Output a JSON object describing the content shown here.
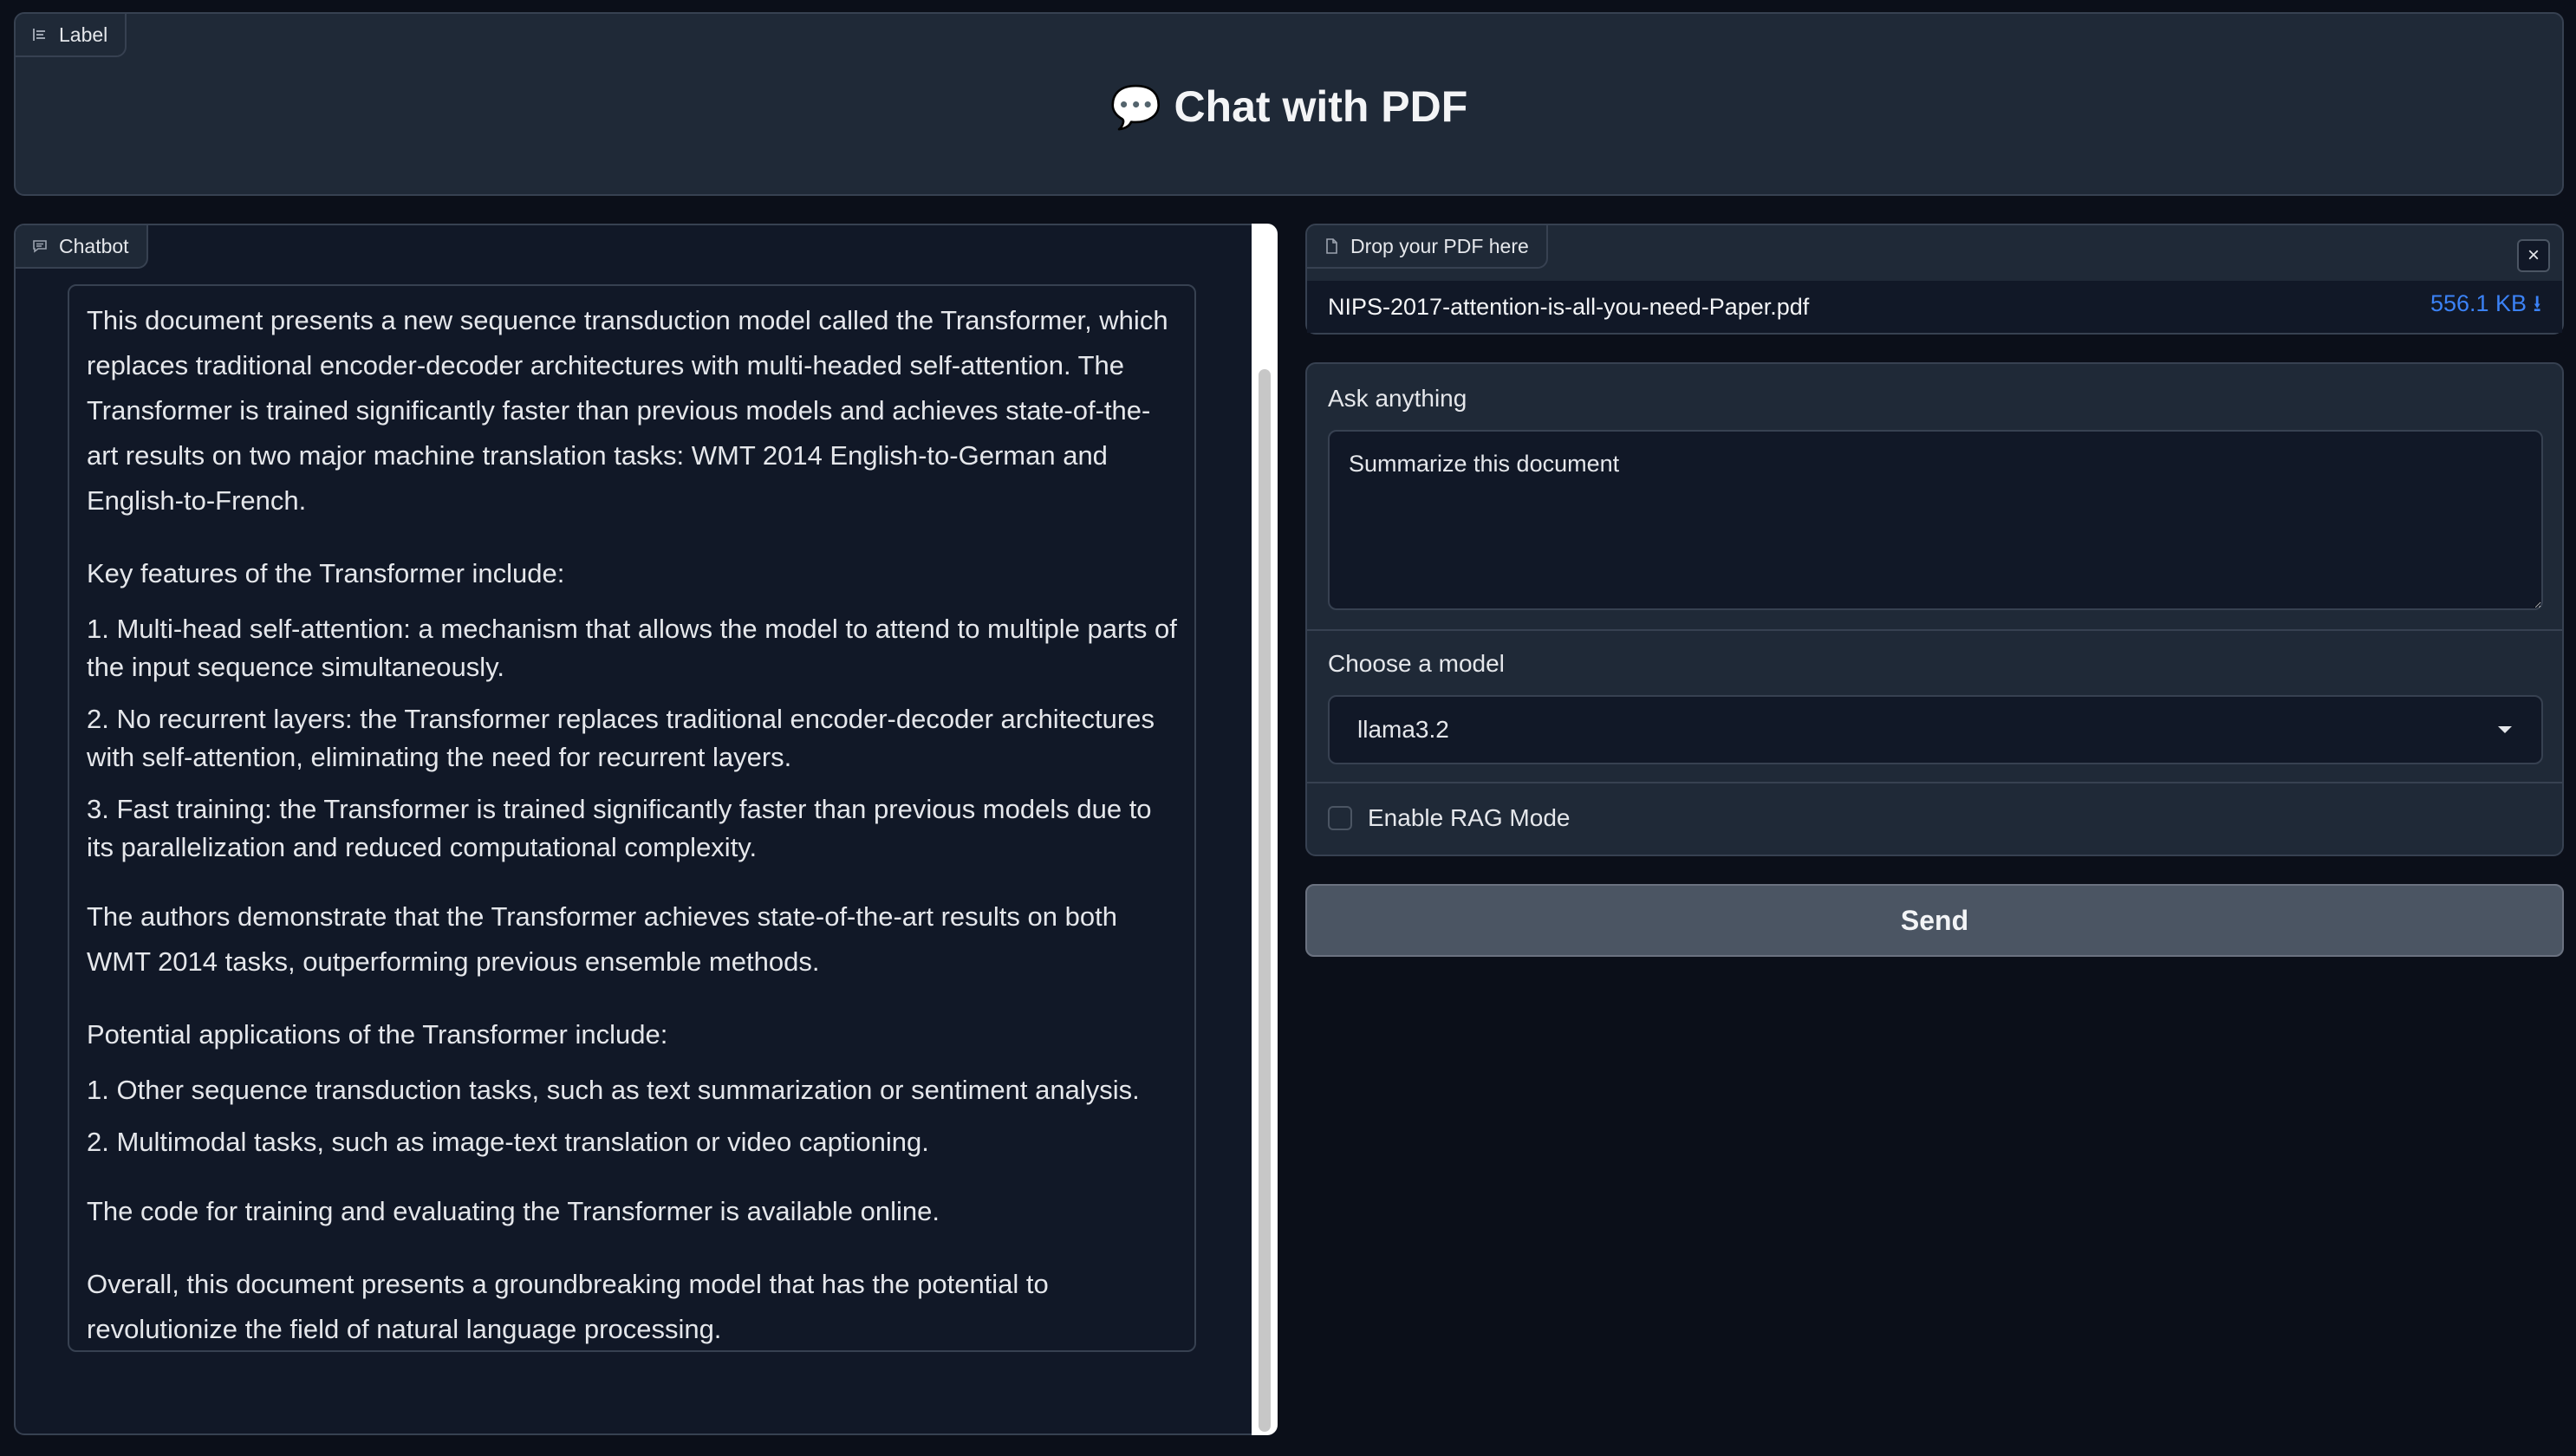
{
  "header": {
    "tag_label": "Label",
    "title": "Chat with PDF",
    "title_icon": "💬"
  },
  "chatbot": {
    "tag_label": "Chatbot",
    "message": {
      "p1": "This document presents a new sequence transduction model called the Transformer, which replaces traditional encoder-decoder architectures with multi-headed self-attention. The Transformer is trained significantly faster than previous models and achieves state-of-the-art results on two major machine translation tasks: WMT 2014 English-to-German and English-to-French.",
      "p2": "Key features of the Transformer include:",
      "li1": "1. Multi-head self-attention: a mechanism that allows the model to attend to multiple parts of the input sequence simultaneously.",
      "li2": "2. No recurrent layers: the Transformer replaces traditional encoder-decoder architectures with self-attention, eliminating the need for recurrent layers.",
      "li3": "3. Fast training: the Transformer is trained significantly faster than previous models due to its parallelization and reduced computational complexity.",
      "p3": "The authors demonstrate that the Transformer achieves state-of-the-art results on both WMT 2014 tasks, outperforming previous ensemble methods.",
      "p4": "Potential applications of the Transformer include:",
      "li4": "1. Other sequence transduction tasks, such as text summarization or sentiment analysis.",
      "li5": "2. Multimodal tasks, such as image-text translation or video captioning.",
      "p5": "The code for training and evaluating the Transformer is available online.",
      "p6": "Overall, this document presents a groundbreaking model that has the potential to revolutionize the field of natural language processing."
    }
  },
  "file_upload": {
    "tag_label": "Drop your PDF here",
    "file_name": "NIPS-2017-attention-is-all-you-need-Paper.pdf",
    "file_size": "556.1 KB ⭳",
    "close_icon": "×"
  },
  "form": {
    "ask_label": "Ask anything",
    "ask_value": "Summarize this document",
    "model_label": "Choose a model",
    "model_value": "llama3.2",
    "rag_label": "Enable RAG Mode",
    "rag_checked": false
  },
  "send_label": "Send",
  "colors": {
    "background": "#0b0f19",
    "panel": "#1f2937",
    "border": "#374151",
    "link": "#3b82f6",
    "button": "#4b5563"
  }
}
